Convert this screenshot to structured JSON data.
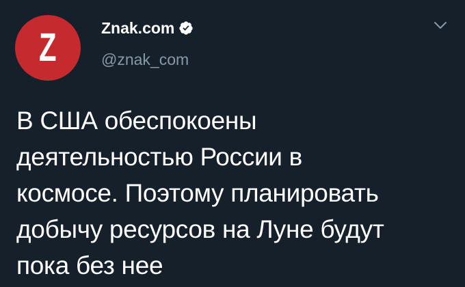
{
  "colors": {
    "background": "#15202b",
    "avatar_bg": "#c42a2e",
    "text": "#ffffff",
    "secondary_text": "#8899a6"
  },
  "account": {
    "avatar_letter": "Z",
    "display_name": "Znak.com",
    "handle": "@znak_com",
    "verified_icon": "verified-badge-icon"
  },
  "menu": {
    "icon": "chevron-down-icon"
  },
  "tweet": {
    "lines": [
      "В США обеспокоены",
      "деятельностью России в",
      "космосе. Поэтому планировать",
      "добычу ресурсов на Луне будут",
      "пока без нее"
    ]
  }
}
